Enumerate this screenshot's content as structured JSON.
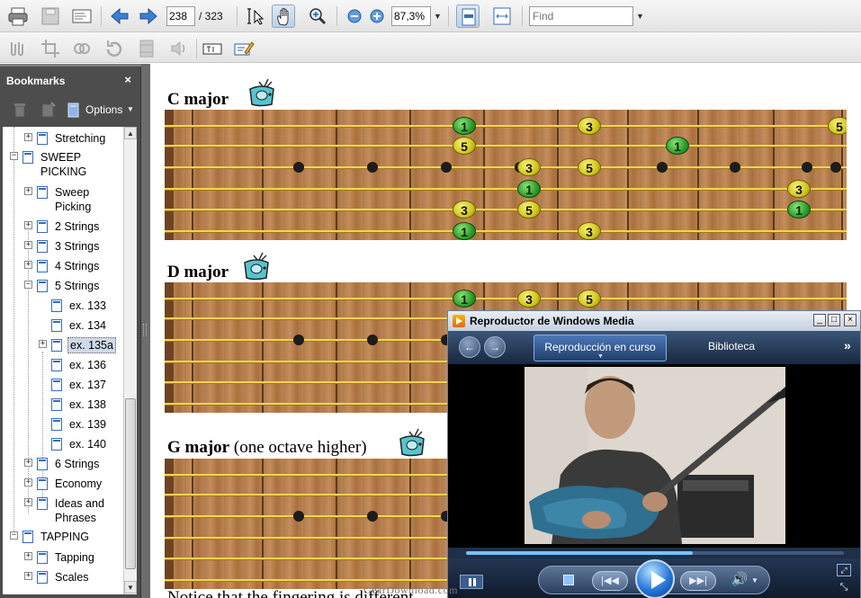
{
  "toolbar": {
    "page_current": "238",
    "page_total": "/ 323",
    "zoom": "87,3%",
    "find_placeholder": "Find"
  },
  "bookmarks": {
    "title": "Bookmarks",
    "close": "×",
    "options_label": "Options",
    "items": [
      {
        "label": "Stretching"
      },
      {
        "label": "SWEEP"
      },
      {
        "label": "PICKING"
      },
      {
        "label": "Sweep"
      },
      {
        "label": "Picking"
      },
      {
        "label": "2 Strings"
      },
      {
        "label": "3 Strings"
      },
      {
        "label": "4 Strings"
      },
      {
        "label": "5 Strings"
      },
      {
        "label": "ex. 133"
      },
      {
        "label": "ex. 134"
      },
      {
        "label": "ex. 135a"
      },
      {
        "label": "ex. 136"
      },
      {
        "label": "ex. 137"
      },
      {
        "label": "ex. 138"
      },
      {
        "label": "ex. 139"
      },
      {
        "label": "ex. 140"
      },
      {
        "label": "6 Strings"
      },
      {
        "label": "Economy"
      },
      {
        "label": "Ideas and"
      },
      {
        "label": "Phrases"
      },
      {
        "label": "TAPPING"
      },
      {
        "label": "Tapping"
      },
      {
        "label": "Scales"
      }
    ]
  },
  "document": {
    "sections": [
      {
        "title": "C major",
        "subtitle": ""
      },
      {
        "title": "D major",
        "subtitle": ""
      },
      {
        "title": "G major",
        "subtitle": " (one octave higher)"
      }
    ],
    "bottom_text": "Notice that the fingering is different",
    "watermark": "GearDownload.com",
    "fretboards": [
      {
        "notes": [
          {
            "fret": 1,
            "string": 1,
            "label": "1",
            "color": "green"
          },
          {
            "fret": 1,
            "string": 2,
            "label": "5",
            "color": "yellow"
          },
          {
            "fret": 1,
            "string": 5,
            "label": "3",
            "color": "yellow"
          },
          {
            "fret": 1,
            "string": 6,
            "label": "1",
            "color": "green"
          },
          {
            "fret": 2,
            "string": 3,
            "label": "3",
            "color": "yellow"
          },
          {
            "fret": 2,
            "string": 4,
            "label": "1",
            "color": "green"
          },
          {
            "fret": 2,
            "string": 5,
            "label": "5",
            "color": "yellow"
          },
          {
            "fret": 3,
            "string": 1,
            "label": "3",
            "color": "yellow"
          },
          {
            "fret": 3,
            "string": 3,
            "label": "5",
            "color": "yellow"
          },
          {
            "fret": 3,
            "string": 6,
            "label": "3",
            "color": "yellow"
          },
          {
            "fret": 4,
            "string": 2,
            "label": "1",
            "color": "green"
          },
          {
            "fret": 5,
            "string": 4,
            "label": "3",
            "color": "yellow"
          },
          {
            "fret": 5,
            "string": 5,
            "label": "1",
            "color": "green"
          },
          {
            "fret": 6,
            "string": 1,
            "label": "5",
            "color": "yellow"
          }
        ]
      },
      {
        "notes": [
          {
            "fret": 1,
            "string": 1,
            "label": "1",
            "color": "green"
          },
          {
            "fret": 2,
            "string": 1,
            "label": "3",
            "color": "yellow"
          },
          {
            "fret": 3,
            "string": 1,
            "label": "5",
            "color": "yellow"
          }
        ]
      },
      {
        "notes": []
      }
    ]
  },
  "media_player": {
    "title": "Reproductor de Windows Media",
    "tab_now_playing": "Reproducción en curso",
    "tab_library": "Biblioteca",
    "progress": 0.6,
    "colors": {
      "accent": "#2677d9",
      "frame": "#1c2a3e"
    }
  }
}
